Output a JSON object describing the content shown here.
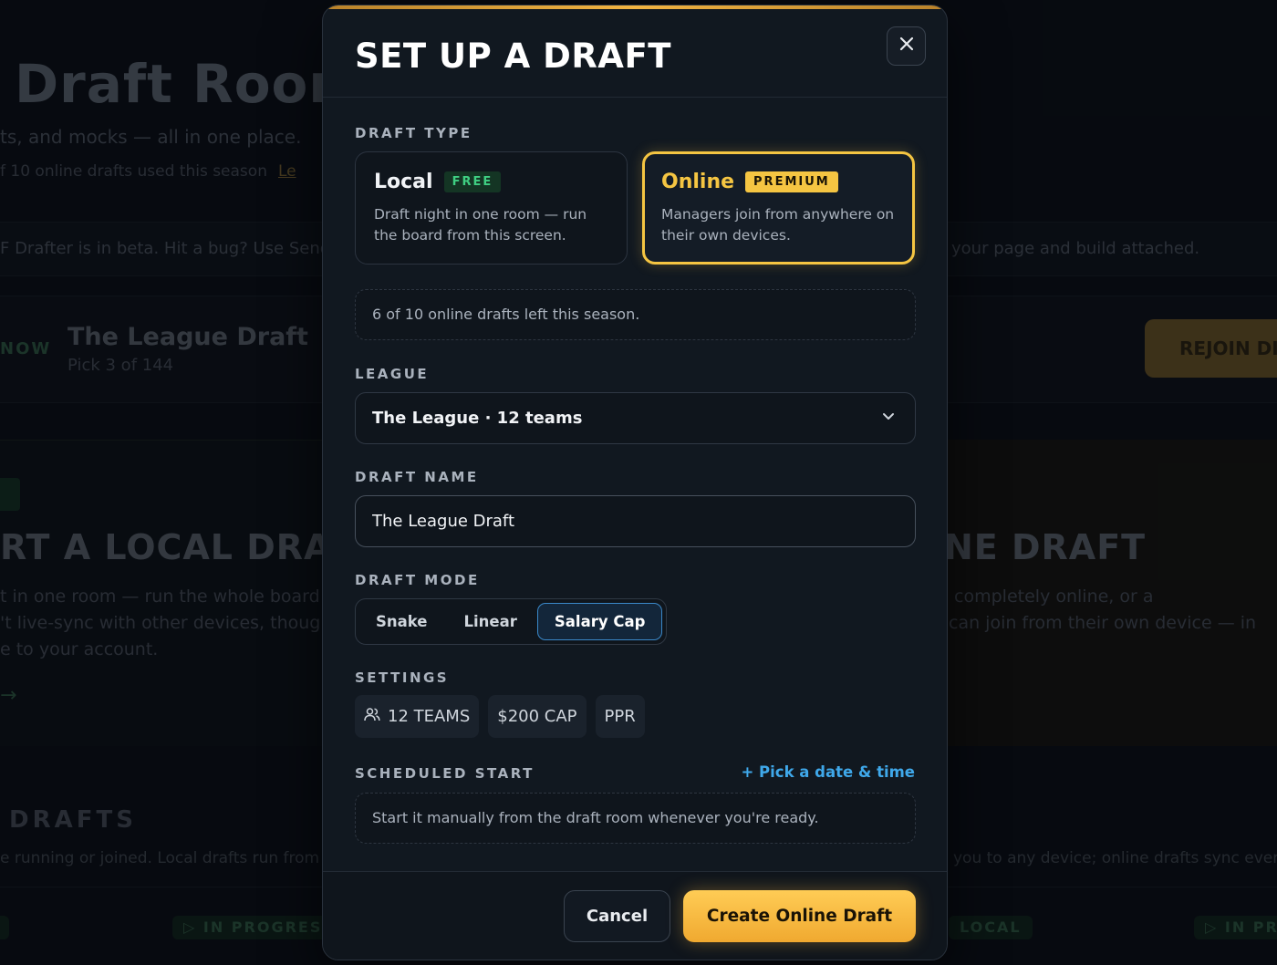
{
  "background": {
    "title": "Draft Room",
    "subtitle": "ts, and mocks — all in one place.",
    "used_text": "f 10 online drafts used this season",
    "used_link": "Le",
    "beta_left": "F Drafter is in beta. Hit a bug? Use Send",
    "beta_right": "your page and build attached.",
    "now_label": "NOW",
    "row_title": "The League Draft",
    "row_sub": "Pick 3 of 144",
    "rejoin": "REJOIN DI",
    "local_title": "RT A LOCAL DRAFT",
    "local_desc": "t in one room — run the whole board fro\n't live-sync with other devices, though\ne to your account.",
    "online_title": "NE DRAFT",
    "online_desc": " completely online, or a\ncan join from their own device — in",
    "arrow": "→",
    "drafts_title": "DRAFTS",
    "drafts_sub": "e running or joined. Local drafts run from t",
    "drafts_sub_right": "you to any device; online drafts sync every",
    "pill_in_progress_1": "▷ IN PROGRESS",
    "pill_local": "LOCAL",
    "pill_in_progress_2": "▷ IN PR"
  },
  "modal": {
    "title": "SET UP A DRAFT",
    "close_icon": "×",
    "draft_type_label": "DRAFT TYPE",
    "types": [
      {
        "name": "Local",
        "badge": "FREE",
        "desc": "Draft night in one room — run the board from this screen.",
        "selected": false
      },
      {
        "name": "Online",
        "badge": "PREMIUM",
        "desc": "Managers join from anywhere on their own devices.",
        "selected": true
      }
    ],
    "drafts_left": "6 of 10 online drafts left this season.",
    "league_label": "LEAGUE",
    "league_value": "The League · 12 teams",
    "draft_name_label": "DRAFT NAME",
    "draft_name_value": "The League Draft",
    "draft_mode_label": "DRAFT MODE",
    "modes": [
      {
        "label": "Snake",
        "active": false
      },
      {
        "label": "Linear",
        "active": false
      },
      {
        "label": "Salary Cap",
        "active": true
      }
    ],
    "settings_label": "SETTINGS",
    "settings": {
      "teams": "12 TEAMS",
      "cap": "$200 CAP",
      "scoring": "PPR"
    },
    "scheduled_label": "SCHEDULED START",
    "pick_link": "+ Pick a date & time",
    "start_text": "Start it manually from the draft room whenever you're ready.",
    "cancel": "Cancel",
    "create": "Create Online Draft"
  },
  "colors": {
    "accent": "#f5c542",
    "link": "#3fa8ea",
    "free_badge": "#3fcf82",
    "segment_active_border": "#3a88c8"
  }
}
